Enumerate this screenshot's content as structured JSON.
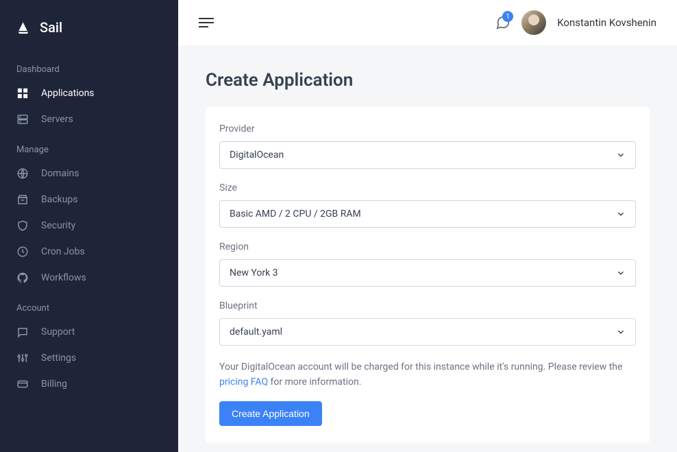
{
  "brand": {
    "name": "Sail"
  },
  "sidebar": {
    "sections": [
      {
        "title": "Dashboard",
        "items": [
          {
            "label": "Applications"
          },
          {
            "label": "Servers"
          }
        ]
      },
      {
        "title": "Manage",
        "items": [
          {
            "label": "Domains"
          },
          {
            "label": "Backups"
          },
          {
            "label": "Security"
          },
          {
            "label": "Cron Jobs"
          },
          {
            "label": "Workflows"
          }
        ]
      },
      {
        "title": "Account",
        "items": [
          {
            "label": "Support"
          },
          {
            "label": "Settings"
          },
          {
            "label": "Billing"
          }
        ]
      }
    ]
  },
  "header": {
    "notif_count": "1",
    "user_name": "Konstantin Kovshenin"
  },
  "page": {
    "title": "Create Application",
    "form": {
      "provider": {
        "label": "Provider",
        "value": "DigitalOcean"
      },
      "size": {
        "label": "Size",
        "value": "Basic AMD / 2 CPU / 2GB RAM"
      },
      "region": {
        "label": "Region",
        "value": "New York 3"
      },
      "blueprint": {
        "label": "Blueprint",
        "value": "default.yaml"
      }
    },
    "notice": {
      "part1": "Your DigitalOcean account will be charged for this instance while it's running. Please review the ",
      "link": "pricing FAQ",
      "part2": " for more information."
    },
    "submit_label": "Create Application"
  }
}
